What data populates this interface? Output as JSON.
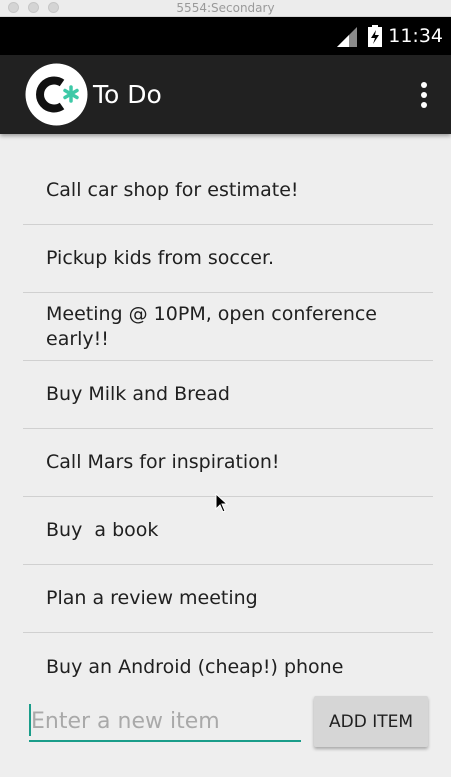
{
  "window": {
    "title": "5554:Secondary"
  },
  "status_bar": {
    "time": "11:34"
  },
  "app_bar": {
    "title": "To Do"
  },
  "list": {
    "items": [
      "Call car shop for estimate!",
      "Pickup kids from soccer.",
      "Meeting @ 10PM, open conference\nearly!!",
      "Buy Milk and Bread",
      "Call Mars for inspiration!",
      "Buy  a book",
      "Plan a review meeting",
      "Buy an Android (cheap!) phone"
    ]
  },
  "new_item": {
    "placeholder": "Enter a new item",
    "value": ""
  },
  "add_button": {
    "label": "ADD ITEM"
  },
  "colors": {
    "accent": "#1a9d8a",
    "app_bar": "#212121",
    "background": "#eeeeee"
  }
}
